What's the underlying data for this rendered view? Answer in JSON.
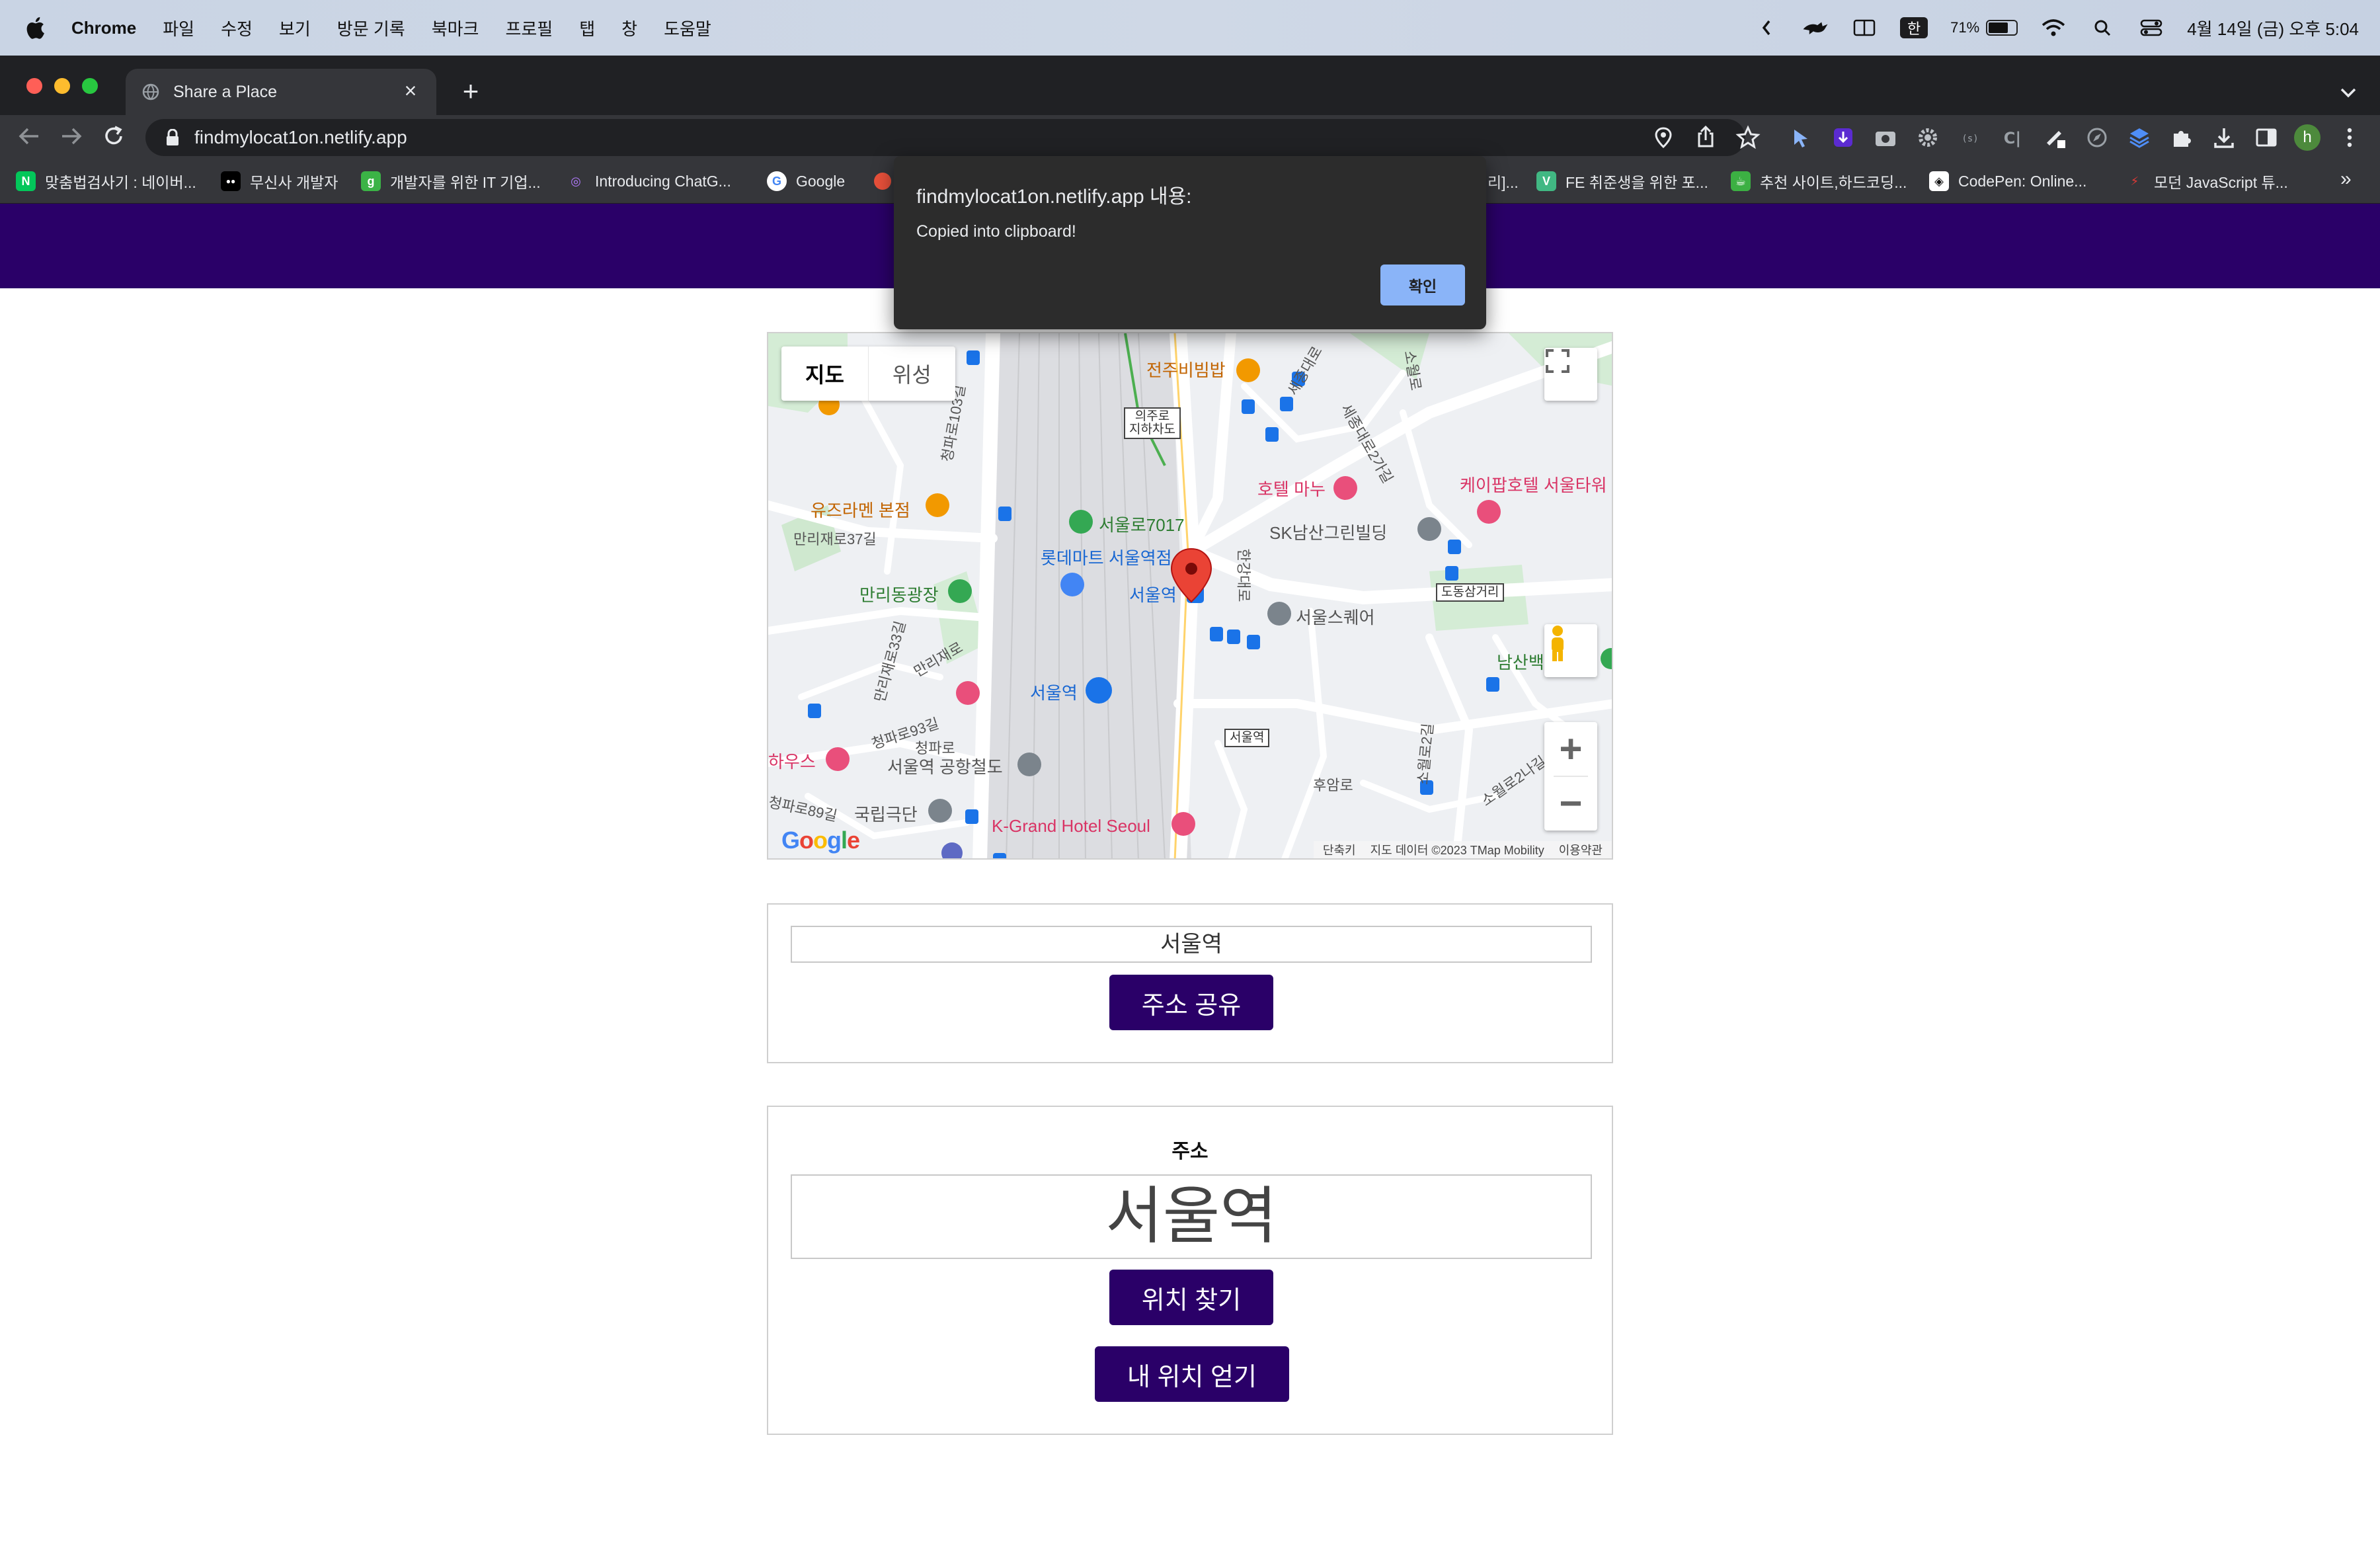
{
  "menubar": {
    "app": "Chrome",
    "menus": [
      "파일",
      "수정",
      "보기",
      "방문 기록",
      "북마크",
      "프로필",
      "탭",
      "창",
      "도움말"
    ],
    "ime": "한",
    "battery_percent": "71%",
    "battery_level": 0.71,
    "datetime": "4월 14일 (금) 오후 5:04"
  },
  "browser": {
    "tab_title": "Share a Place",
    "url": "findmylocat1on.netlify.app",
    "profile_initial": "h",
    "bookmarks": [
      {
        "label": "맞춤법검사기 : 네이버...",
        "icon": "N",
        "color": "#03c75a"
      },
      {
        "label": "무신사 개발자",
        "icon": "●●",
        "color": "#000000"
      },
      {
        "label": "개발자를 위한 IT 기업...",
        "icon": "g",
        "color": "#3bb346"
      },
      {
        "label": "Introducing ChatG...",
        "icon": "◎",
        "color": "#7b3fbf"
      },
      {
        "label": "Google",
        "icon": "G",
        "color": "#ffffff"
      },
      {
        "label": "리]...",
        "icon": "",
        "color": "#35363a"
      },
      {
        "label": "FE 취준생을 위한 포...",
        "icon": "V",
        "color": "#41b883"
      },
      {
        "label": "추천 사이트,하드코딩...",
        "icon": "☕",
        "color": "#3cb043"
      },
      {
        "label": "CodePen: Online...",
        "icon": "◈",
        "color": "#111111"
      },
      {
        "label": "모던 JavaScript 튜...",
        "icon": "⚡",
        "color": "#35363a"
      }
    ]
  },
  "dialog": {
    "title": "findmylocat1on.netlify.app 내용:",
    "message": "Copied into clipboard!",
    "ok_label": "확인"
  },
  "map": {
    "type_buttons": [
      "지도",
      "위성"
    ],
    "labels": {
      "jeonju": "전주비빔밥",
      "hotel_manu": "호텔 마누",
      "kpop_hotel": "케이팝호텔 서울타워",
      "yuzu": "유즈라멘 본점",
      "seoullo": "서울로7017",
      "lotte": "롯데마트 서울역점",
      "seoul_station": "서울역",
      "sk": "SK남산그린빌딩",
      "manri_square": "만리동광장",
      "seoul_square": "서울스퀘어",
      "namsan": "남산백",
      "bus_seoul": "서울역",
      "airport": "서울역 공항철도",
      "kgrand": "K-Grand Hotel Seoul",
      "national": "국립극단",
      "house": "하우스",
      "dongsam": "도동삼거리",
      "uiju": "의주로\n지하차도",
      "seoulyeok_box": "서울역",
      "huam": "후암로",
      "manrijae37": "만리재로37길",
      "manrijae": "만리재로",
      "cheongpa": "청파로",
      "cheongpa93": "청파로93길",
      "cheongpa89": "청파로89길",
      "cheongpa103": "청파로103길",
      "hangang": "한강대로",
      "sejong": "세종대로",
      "sejong2": "세종대로2가길",
      "sowol": "소월로",
      "sowol2": "소월로2길",
      "sowol2na": "소월로2나길",
      "manrijae33": "만리재로33길"
    },
    "footer": [
      "단축키",
      "지도 데이터 ©2023 TMap Mobility",
      "이용약관"
    ],
    "logo": "Google"
  },
  "share_card": {
    "address_value": "서울역",
    "share_button": "주소 공유"
  },
  "search_card": {
    "title": "주소",
    "address_value": "서울역",
    "find_button": "위치 찾기",
    "my_location_button": "내 위치 얻기"
  },
  "colors": {
    "header": "#2a0068",
    "button": "#2a0068",
    "dialog_ok": "#8ab4f8"
  }
}
